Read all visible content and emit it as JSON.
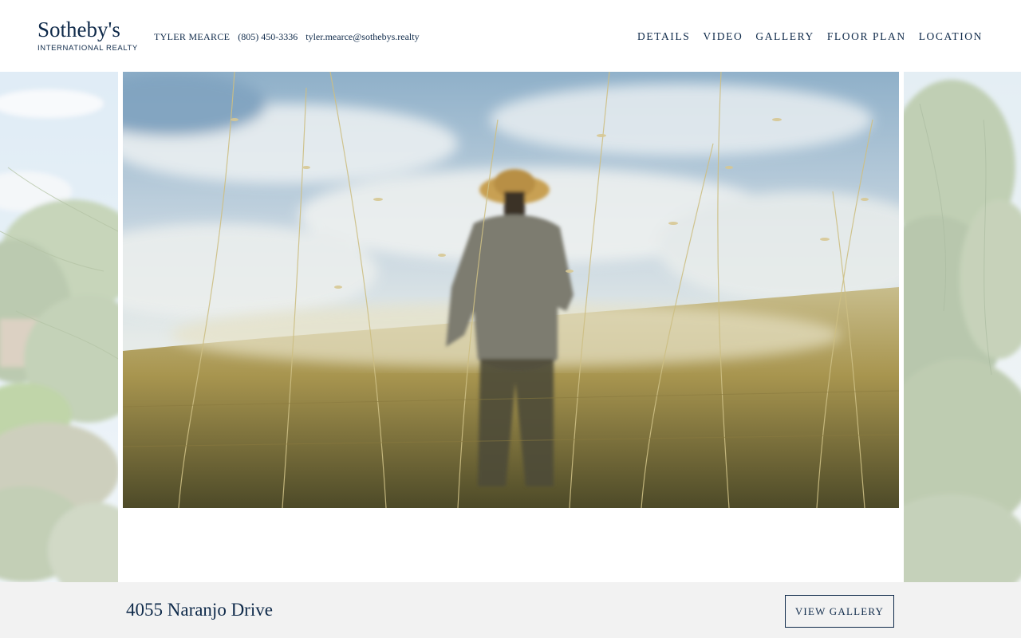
{
  "brand": {
    "name": "Sotheby's",
    "subtitle": "INTERNATIONAL REALTY",
    "color": "#0f2a4a"
  },
  "contact": {
    "agent": "TYLER MEARCE",
    "phone": "(805) 450-3336",
    "email": "tyler.mearce@sothebys.realty"
  },
  "nav": {
    "items": [
      {
        "label": "DETAILS"
      },
      {
        "label": "VIDEO"
      },
      {
        "label": "GALLERY"
      },
      {
        "label": "FLOOR PLAN"
      },
      {
        "label": "LOCATION"
      }
    ]
  },
  "hero": {
    "media": "video"
  },
  "footer": {
    "address": "4055 Naranjo Drive",
    "gallery_button": "VIEW GALLERY",
    "bar_color": "#f2f2f2"
  }
}
